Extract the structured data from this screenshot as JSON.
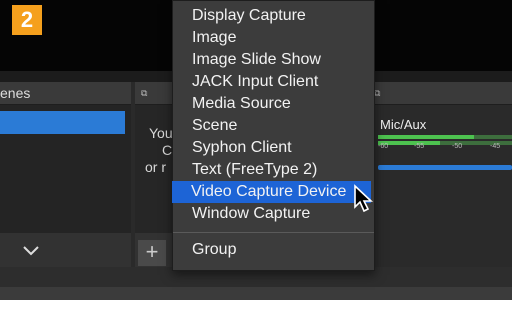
{
  "badge": {
    "step": "2"
  },
  "scenes": {
    "header": "enes"
  },
  "sources": {
    "hint_lines": [
      "You",
      "C",
      "or r"
    ]
  },
  "mixer": {
    "label": "Mic/Aux",
    "ticks": [
      "-60",
      "-55",
      "-50",
      "-45"
    ]
  },
  "menu": {
    "items": [
      "Display Capture",
      "Image",
      "Image Slide Show",
      "JACK Input Client",
      "Media Source",
      "Scene",
      "Syphon Client",
      "Text (FreeType 2)",
      "Video Capture Device",
      "Window Capture"
    ],
    "selected_index": 8,
    "group_item": "Group"
  },
  "icons": {
    "add": "+",
    "chevron": "chevron-down-icon",
    "popout": "popout-icon",
    "cursor": "mouse-pointer-icon"
  },
  "colors": {
    "badge": "#f5a01d",
    "selection": "#1d64d6",
    "meter": "#4dc24f"
  }
}
